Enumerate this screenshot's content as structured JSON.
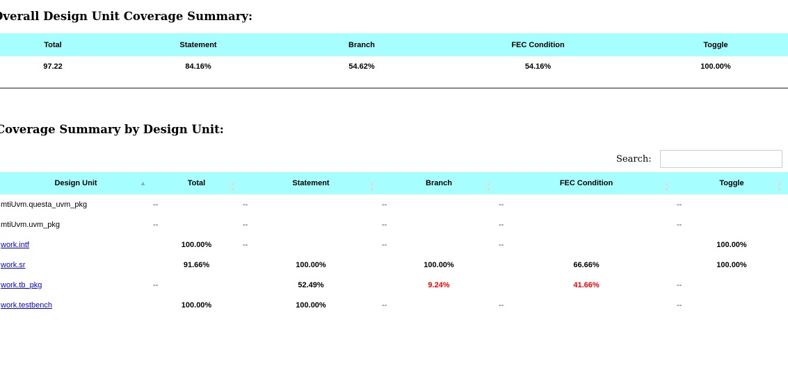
{
  "overall": {
    "title": "Overall Design Unit Coverage Summary:",
    "headers": [
      "Total",
      "Statement",
      "Branch",
      "FEC Condition",
      "Toggle"
    ],
    "values": [
      "97.22",
      "84.16%",
      "54.62%",
      "54.16%",
      "100.00%"
    ]
  },
  "by_unit": {
    "title": "Coverage Summary by Design Unit:",
    "search": {
      "label": "Search:",
      "value": "",
      "placeholder": ""
    },
    "headers": [
      "Design Unit",
      "Total",
      "Statement",
      "Branch",
      "FEC Condition",
      "Toggle"
    ],
    "rows": [
      {
        "name": "mtiUvm.questa_uvm_pkg",
        "link": false,
        "total": "--",
        "statement": "--",
        "branch": "--",
        "fec": "--",
        "toggle": "--"
      },
      {
        "name": "mtiUvm.uvm_pkg",
        "link": false,
        "total": "--",
        "statement": "--",
        "branch": "--",
        "fec": "--",
        "toggle": "--"
      },
      {
        "name": "work.intf",
        "link": true,
        "total": "100.00%",
        "statement": "--",
        "branch": "--",
        "fec": "--",
        "toggle": "100.00%"
      },
      {
        "name": "work.sr",
        "link": true,
        "total": "91.66%",
        "statement": "100.00%",
        "branch": "100.00%",
        "fec": "66.66%",
        "toggle": "100.00%"
      },
      {
        "name": "work.tb_pkg",
        "link": true,
        "total": "--",
        "statement": "52.49%",
        "branch": "9.24%",
        "fec": "41.66%",
        "toggle": "--"
      },
      {
        "name": "work.testbench",
        "link": true,
        "total": "100.00%",
        "statement": "100.00%",
        "branch": "--",
        "fec": "--",
        "toggle": "--"
      }
    ],
    "low_color": "#ff0000",
    "header_color": "#a7feff",
    "link_color": "#0000ee"
  }
}
